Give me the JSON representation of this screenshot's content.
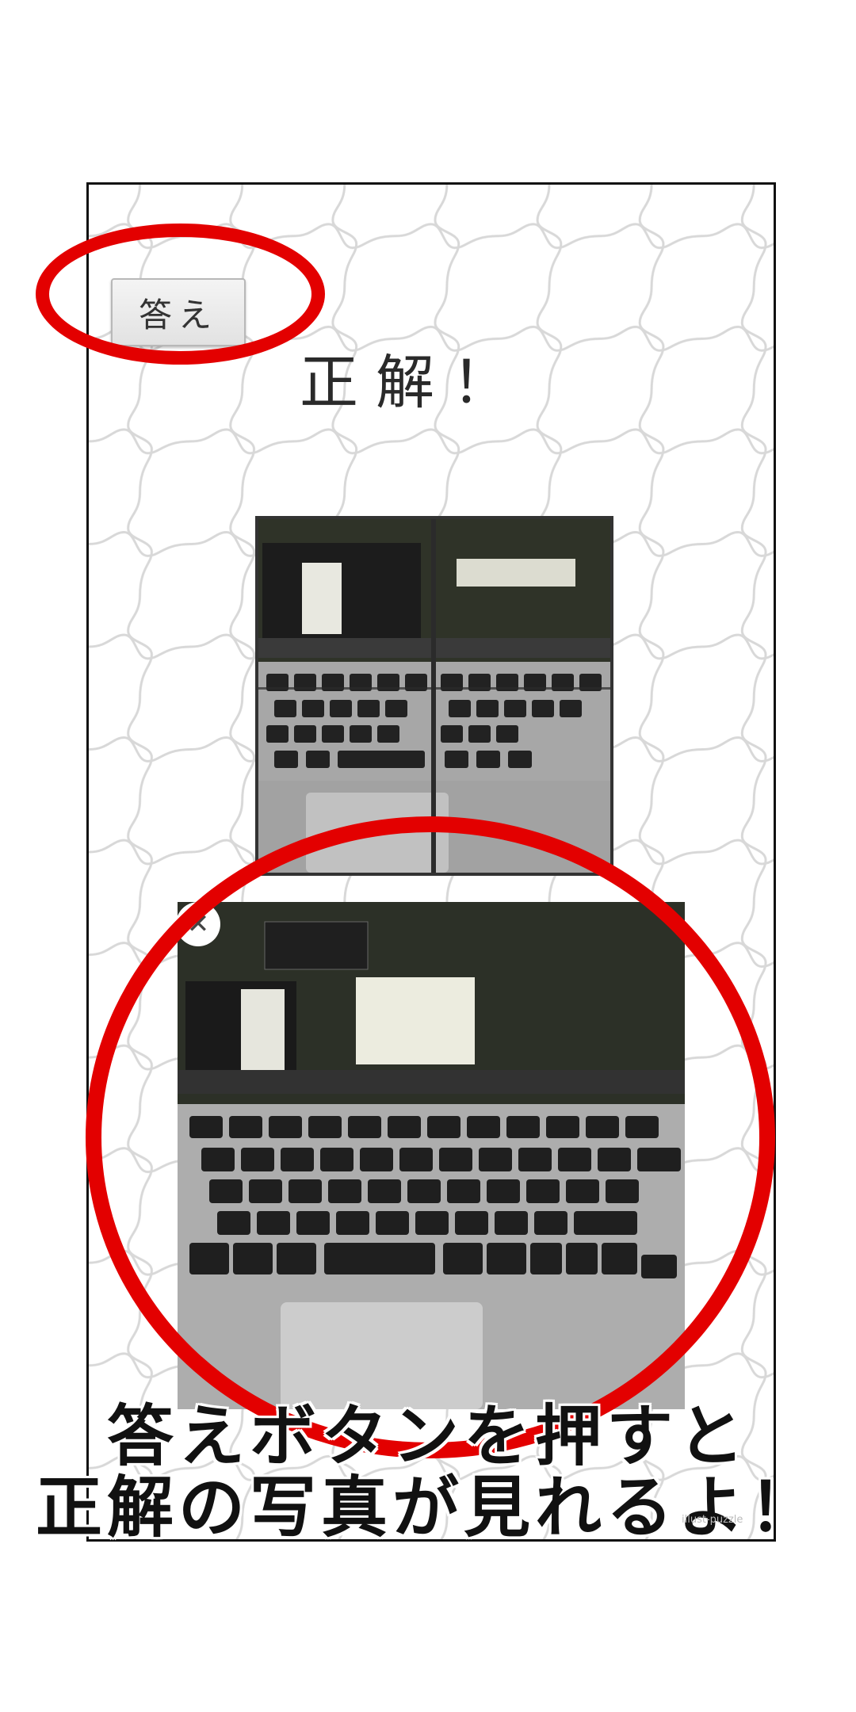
{
  "answer_button": {
    "label": "答え"
  },
  "result": {
    "text": "正解！"
  },
  "preview": {
    "close_symbol": "✕"
  },
  "caption": {
    "line1": "答えボタンを押すと",
    "line2": "正解の写真が見れるよ！"
  },
  "watermark": {
    "text": "illust-puzzle"
  },
  "colors": {
    "highlight_ring": "#e30000",
    "frame": "#111111",
    "background": "#ffffff"
  },
  "icons": [
    "answer-button",
    "close-icon",
    "puzzle-background"
  ]
}
